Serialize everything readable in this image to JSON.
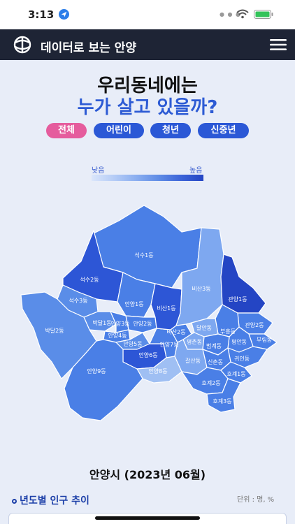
{
  "status": {
    "time": "3:13"
  },
  "app": {
    "title": "데이터로 보는 안양"
  },
  "heading": {
    "line1": "우리동네에는",
    "line2": "누가 살고 있을까?"
  },
  "tabs": [
    {
      "label": "전체",
      "active": true
    },
    {
      "label": "어린이",
      "active": false
    },
    {
      "label": "청년",
      "active": false
    },
    {
      "label": "신중년",
      "active": false
    }
  ],
  "legend": {
    "low": "낮음",
    "high": "높음"
  },
  "districts": [
    {
      "name": "석수1동",
      "color": "#4a7fe6"
    },
    {
      "name": "석수2동",
      "color": "#2d56d6"
    },
    {
      "name": "석수3동",
      "color": "#5a8de8"
    },
    {
      "name": "박달1동",
      "color": "#5a8de8"
    },
    {
      "name": "박달2동",
      "color": "#5a8de8"
    },
    {
      "name": "안양1동",
      "color": "#4a7fe6"
    },
    {
      "name": "안양2동",
      "color": "#4a7fe6"
    },
    {
      "name": "안양3동",
      "color": "#4a7fe6"
    },
    {
      "name": "안양4동",
      "color": "#4a7fe6"
    },
    {
      "name": "안양5동",
      "color": "#5a8de8"
    },
    {
      "name": "안양6동",
      "color": "#2d56d6"
    },
    {
      "name": "안양7동",
      "color": "#4a7fe6"
    },
    {
      "name": "안양8동",
      "color": "#9fbff3"
    },
    {
      "name": "안양9동",
      "color": "#4a7fe6"
    },
    {
      "name": "비산1동",
      "color": "#2d56d6"
    },
    {
      "name": "비산2동",
      "color": "#4a7fe6"
    },
    {
      "name": "비산3동",
      "color": "#7ea8f0"
    },
    {
      "name": "관양1동",
      "color": "#2445c4"
    },
    {
      "name": "관양2동",
      "color": "#4a7fe6"
    },
    {
      "name": "부림동",
      "color": "#4a7fe6"
    },
    {
      "name": "부흥동",
      "color": "#4a7fe6"
    },
    {
      "name": "달안동",
      "color": "#7ea8f0"
    },
    {
      "name": "평촌동",
      "color": "#7ea8f0"
    },
    {
      "name": "평안동",
      "color": "#4a7fe6"
    },
    {
      "name": "범계동",
      "color": "#4a7fe6"
    },
    {
      "name": "귀인동",
      "color": "#4a7fe6"
    },
    {
      "name": "신촌동",
      "color": "#4a7fe6"
    },
    {
      "name": "갈산동",
      "color": "#7ea8f0"
    },
    {
      "name": "호계1동",
      "color": "#4a7fe6"
    },
    {
      "name": "호계2동",
      "color": "#4a7fe6"
    },
    {
      "name": "호계3동",
      "color": "#4a7fe6"
    }
  ],
  "city": {
    "label": "안양시 (2023년 06월)"
  },
  "section": {
    "title": "년도별 인구 추이",
    "unit": "단위 : 명, %"
  },
  "colors": {
    "accent": "#2b58d6",
    "active_tab": "#e55c9d",
    "header": "#1e2435"
  }
}
